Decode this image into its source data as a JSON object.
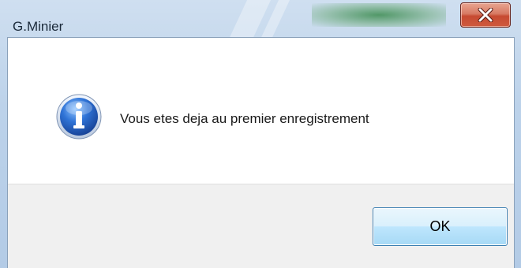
{
  "window": {
    "title": "G.Minier",
    "close_icon": "close-x-icon",
    "close_button_color": "#c64a31"
  },
  "dialog": {
    "icon": "info-icon",
    "icon_color": "#2a64c8",
    "message": "Vous etes deja au premier enregistrement",
    "ok_label": "OK"
  }
}
